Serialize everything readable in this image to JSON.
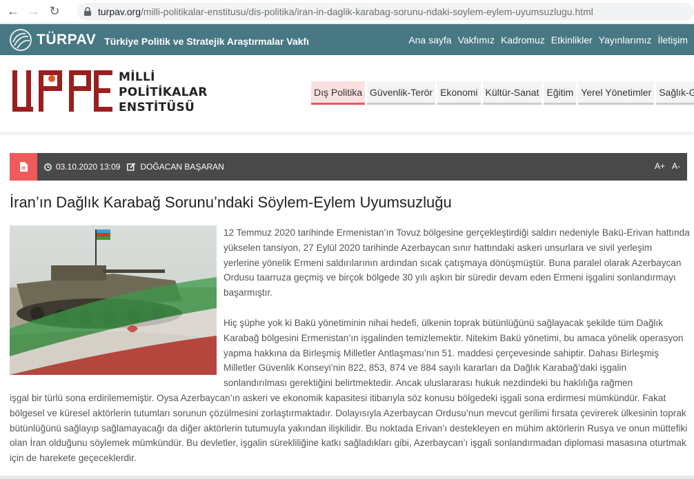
{
  "browser": {
    "url_host": "turpav.org",
    "url_path": "/milli-politikalar-enstitusu/dis-politika/iran-in-daglik-karabag-sorunu-ndaki-soylem-eylem-uyumsuzlugu.html"
  },
  "topbar": {
    "brand": "TÜRPAV",
    "subtitle": "Türkiye Politik ve Stratejik Araştırmalar Vakfı",
    "nav": [
      "Ana sayfa",
      "Vakfımız",
      "Kadromuz",
      "Etkinlikler",
      "Yayınlarımız",
      "İletişim"
    ]
  },
  "site": {
    "logo_lines": [
      "MİLLİ",
      "POLİTİKALAR",
      "ENSTİTÜSÜ"
    ],
    "categories": [
      "Dış Politika",
      "Güvenlik-Terör",
      "Ekonomi",
      "Kültür-Sanat",
      "Eğitim",
      "Yerel Yönetimler",
      "Sağlık-Gıda"
    ],
    "active_category": "Dış Politika"
  },
  "meta": {
    "datetime": "03.10.2020 13:09",
    "author": "DOĞACAN BAŞARAN",
    "font_increase": "A+",
    "font_decrease": "A-"
  },
  "article": {
    "title": "İran’ın Dağlık Karabağ Sorunu’ndaki Söylem-Eylem Uyumsuzluğu",
    "p1": "12 Temmuz 2020 tarihinde Ermenistan’ın Tovuz bölgesine gerçekleştirdiği saldırı nedeniyle Bakü-Erivan hattında yükselen tansiyon, 27 Eylül 2020 tarihinde Azerbaycan sınır hattındaki askeri unsurlara ve sivil yerleşim yerlerine yönelik Ermeni saldırılarının ardından sıcak çatışmaya dönüşmüştür. Buna paralel olarak Azerbaycan Ordusu taarruza geçmiş ve birçok bölgede 30 yılı aşkın bir süredir devam eden Ermeni işgalini sonlandırmayı başarmıştır.",
    "p2_part1": "Hiç şüphe yok ki Bakü yönetiminin nihai hedefi, ülkenin toprak bütünlüğünü sağlayacak şekilde tüm Dağlık Karabağ bölgesini Ermenistan’ın işgalinden temizlemektir. Nitekim Bakü yönetimi, bu amaca yönelik operasyon yapma hakkına da Birleşmiş Milletler Antlaşması’nın 51. maddesi çerçevesinde sahiptir. Dahası Birleşmiş Milletler Güvenlik Konseyi’nin 822, 853, 874 ve 884 sayılı kararları da Dağlık Karabağ’daki işgalin sonlandırılması gerektiğini belirtmektedir. Ancak uluslararası hukuk nezdindeki bu haklılığa rağmen",
    "p2_part2": "işgal bir türlü sona erdirilememiştir. Oysa Azerbaycan’ın askeri ve ekonomik kapasitesi itibarıyla söz konusu bölgedeki işgali sona erdirmesi mümkündür. Fakat bölgesel ve küresel aktörlerin tutumları sorunun çözülmesini zorlaştırmaktadır. Dolayısıyla Azerbaycan Ordusu’nun mevcut gerilimi fırsata çevirerek ülkesinin toprak bütünlüğünü sağlayıp sağlamayacağı da diğer aktörlerin tutumuyla yakından ilişkilidir. Bu noktada Erivan’ı destekleyen en mühim aktörlerin Rusya ve onun müttefiki olan İran olduğunu söylemek mümkündür. Bu devletler, işgalin sürekliliğine katkı sağladıkları gibi, Azerbaycan’ı işgali sonlandırmadan diplomasi masasına oturtmak için de harekete geçeceklerdir."
  },
  "colors": {
    "topbar": "#477884",
    "accent_red": "#f05a5a",
    "logo_red": "#9b1f1f",
    "metabar": "#494949"
  }
}
